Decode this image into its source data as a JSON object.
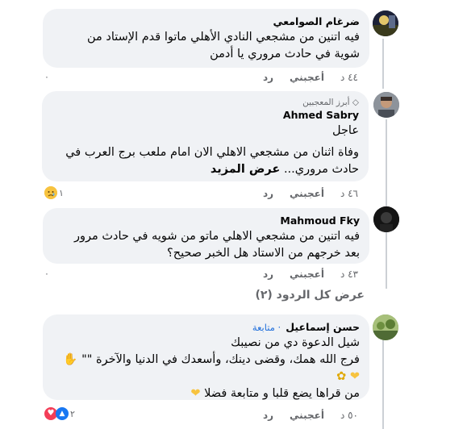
{
  "comments": [
    {
      "author": "ضرغام الصوامعي",
      "lines": [
        "فيه اتنين من مشجعي النادي الأهلي ماتوا قدم الإستاد من",
        "شوية في حادث مروري يا أدمن"
      ],
      "time": "٤٤ د",
      "like": "أعجبني",
      "reply": "رد",
      "reaction_count": "٠"
    },
    {
      "badge": "أبرز المعجبين",
      "author": "Ahmed Sabry",
      "lines": [
        "عاجل",
        "وفاة اثنان من مشجعي الاهلي الان امام ملعب برج العرب في",
        "حادث مروري..."
      ],
      "see_more": "عرض المزيد",
      "time": "٤٦ د",
      "like": "أعجبني",
      "reply": "رد",
      "reaction_count": "١"
    },
    {
      "author": "Mahmoud Fky",
      "lines": [
        "فيه اتنين من مشجعي الاهلي ماتو من شويه في حادث مرور",
        "بعد خرجهم من الاستاد هل الخبر صحيح؟"
      ],
      "time": "٤٣ د",
      "like": "أعجبني",
      "reply": "رد",
      "reaction_count": "٠"
    },
    {
      "author": "حسن إسماعيل",
      "follow": "متابعة",
      "lines": [
        "شيل الدعوة دي من نصيبك",
        "فرج الله همك، وقضى دينك، وأسعدك في الدنيا والآخرة \"\"",
        "",
        "من قراها يضع قلبا و متابعة فضلا"
      ],
      "time": "٥٠ د",
      "like": "أعجبني",
      "reply": "رد",
      "reaction_count": "٢"
    }
  ],
  "view_all_replies": "عرض كل الردود (٢)",
  "colors": {
    "bubble": "#f0f2f5",
    "secondary_text": "#65676b",
    "follow_link": "#216fdb",
    "thread_line": "#ccd0d5"
  }
}
